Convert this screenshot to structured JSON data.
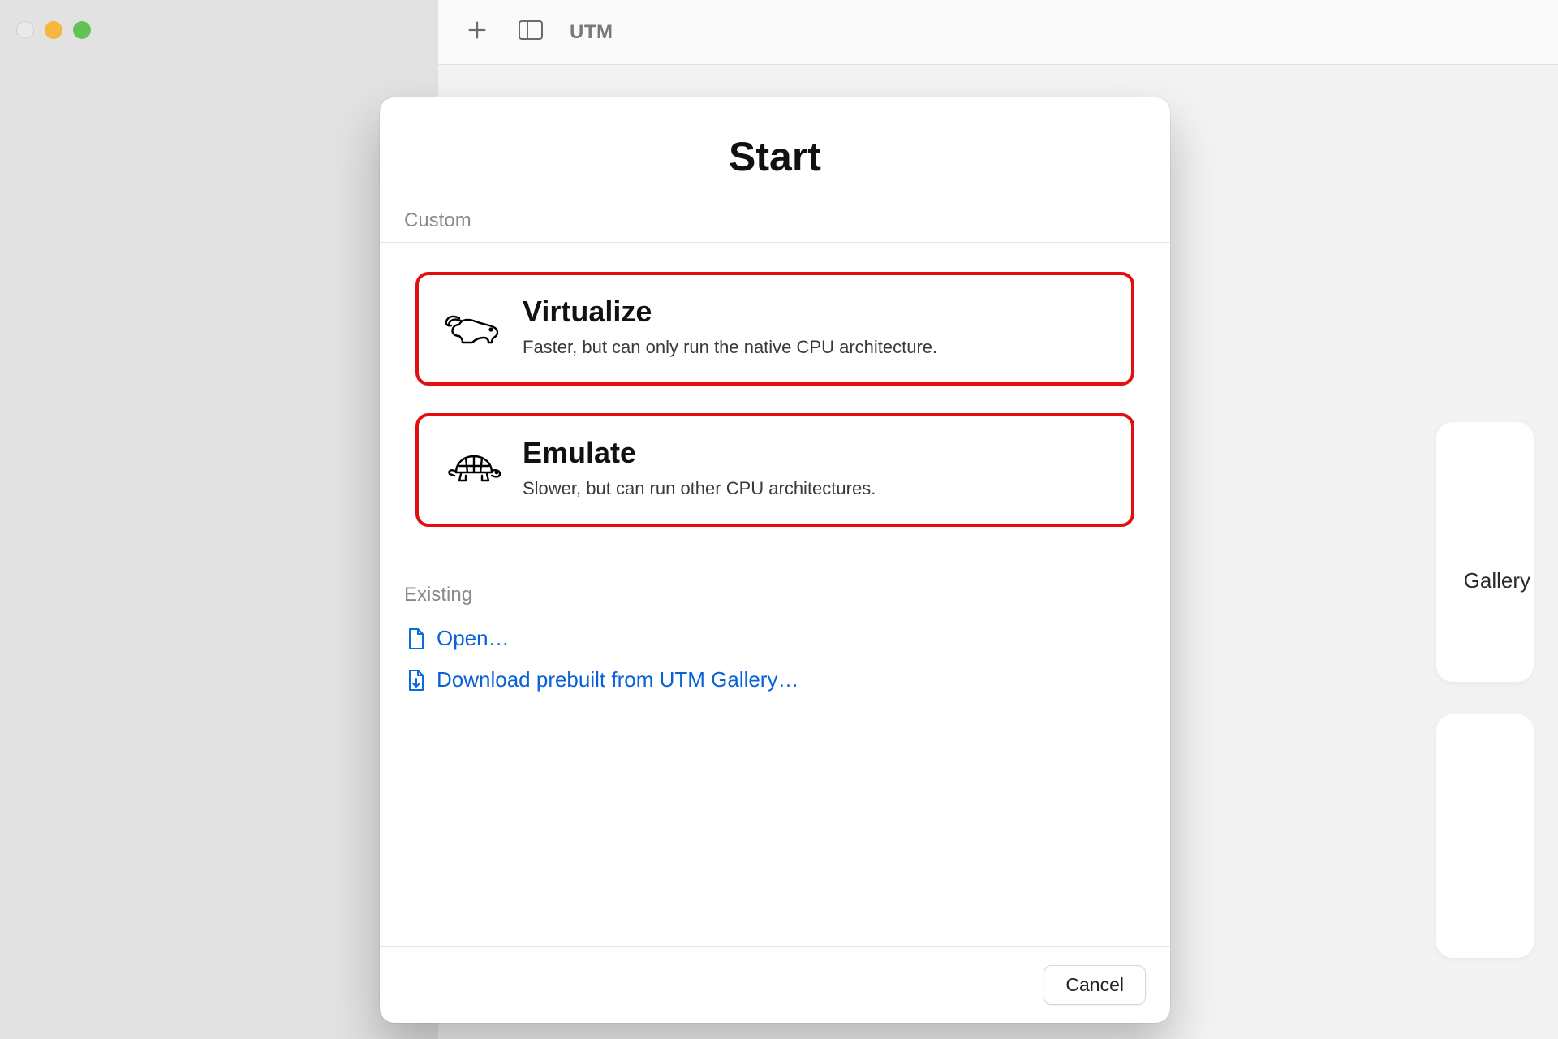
{
  "app": {
    "title": "UTM"
  },
  "modal": {
    "title": "Start",
    "sections": {
      "custom_label": "Custom",
      "existing_label": "Existing"
    },
    "options": [
      {
        "title": "Virtualize",
        "desc": "Faster, but can only run the native CPU architecture."
      },
      {
        "title": "Emulate",
        "desc": "Slower, but can run other CPU architectures."
      }
    ],
    "links": {
      "open": "Open…",
      "download": "Download prebuilt from UTM Gallery…"
    },
    "cancel": "Cancel"
  },
  "background": {
    "gallery_label": "Gallery"
  }
}
